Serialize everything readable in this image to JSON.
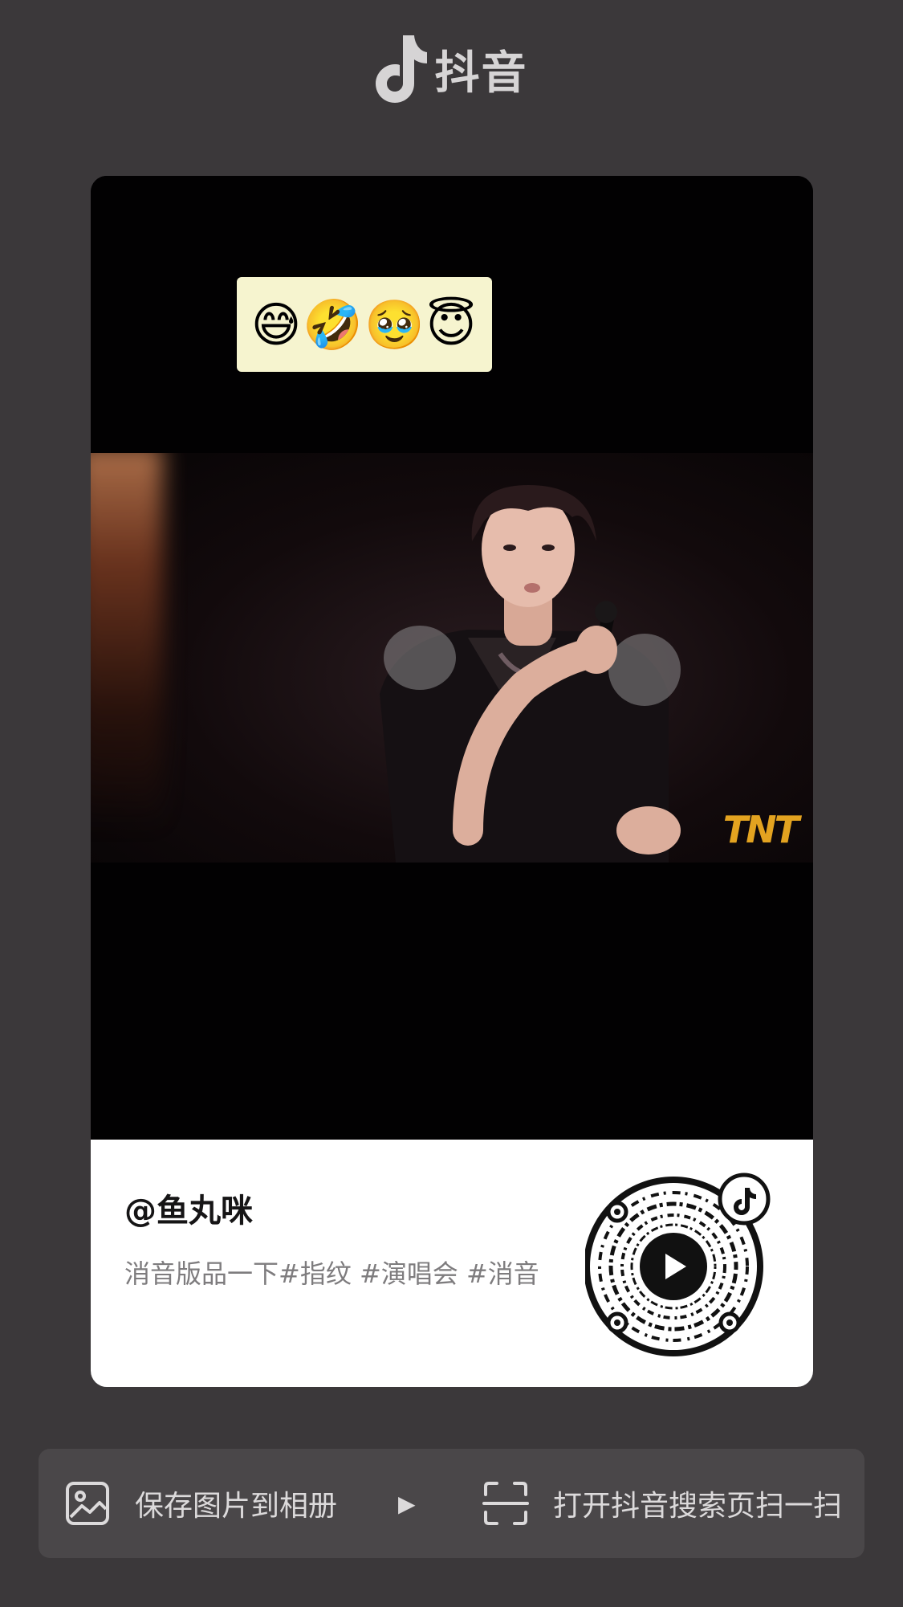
{
  "header": {
    "app_name": "抖音",
    "logo_icon": "tiktok-note-icon"
  },
  "video": {
    "emojis": "😅🤣🥹😇",
    "watermark": "TNT"
  },
  "info": {
    "author": "@鱼丸咪",
    "description": "消音版品一下#指纹 #演唱会 #消音",
    "qr_icon": "play-icon"
  },
  "actions": {
    "save_label": "保存图片到相册",
    "scan_label": "打开抖音搜索页扫一扫"
  },
  "colors": {
    "background": "#3b383a",
    "card": "#020102",
    "banner": "#f6f4cf",
    "watermark": "#e3a320"
  }
}
